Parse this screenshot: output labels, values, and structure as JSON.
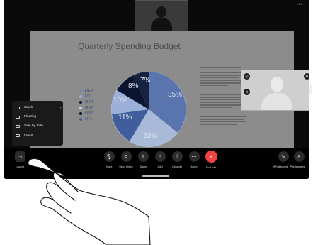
{
  "status_bar": {
    "time": "14:5 ..."
  },
  "presentation": {
    "title": "Quarterly Spending Budget",
    "legend": [
      {
        "label": "DEV",
        "color": "#6d87c0"
      },
      {
        "label": "UX",
        "color": "#9ab0d8"
      },
      {
        "label": "MGT",
        "color": "#0b1530"
      },
      {
        "label": "MKT",
        "color": "#c3cfe6"
      },
      {
        "label": "OPS",
        "color": "#071026"
      },
      {
        "label": "UTL",
        "color": "#3f5e9b"
      }
    ],
    "pie_labels": [
      "35%",
      "23%",
      "11%",
      "10%",
      "8%",
      "7%"
    ]
  },
  "layout_menu": {
    "items": [
      {
        "label": "Stack",
        "selected": true
      },
      {
        "label": "Floating",
        "selected": false
      },
      {
        "label": "Side by Side",
        "selected": false
      },
      {
        "label": "Focus",
        "selected": false
      }
    ],
    "check_glyph": "✓"
  },
  "controls": {
    "layout": "Layout",
    "mute": "Mute",
    "stop_video": "Stop Video",
    "share": "Share",
    "add": "Add",
    "keypad": "Keypad",
    "more": "More",
    "end_call": "End call",
    "whiteboard": "Whiteboard",
    "participants": "Participants"
  },
  "colors": {
    "end_call": "#ef4343",
    "accent": "#3d9df5"
  }
}
